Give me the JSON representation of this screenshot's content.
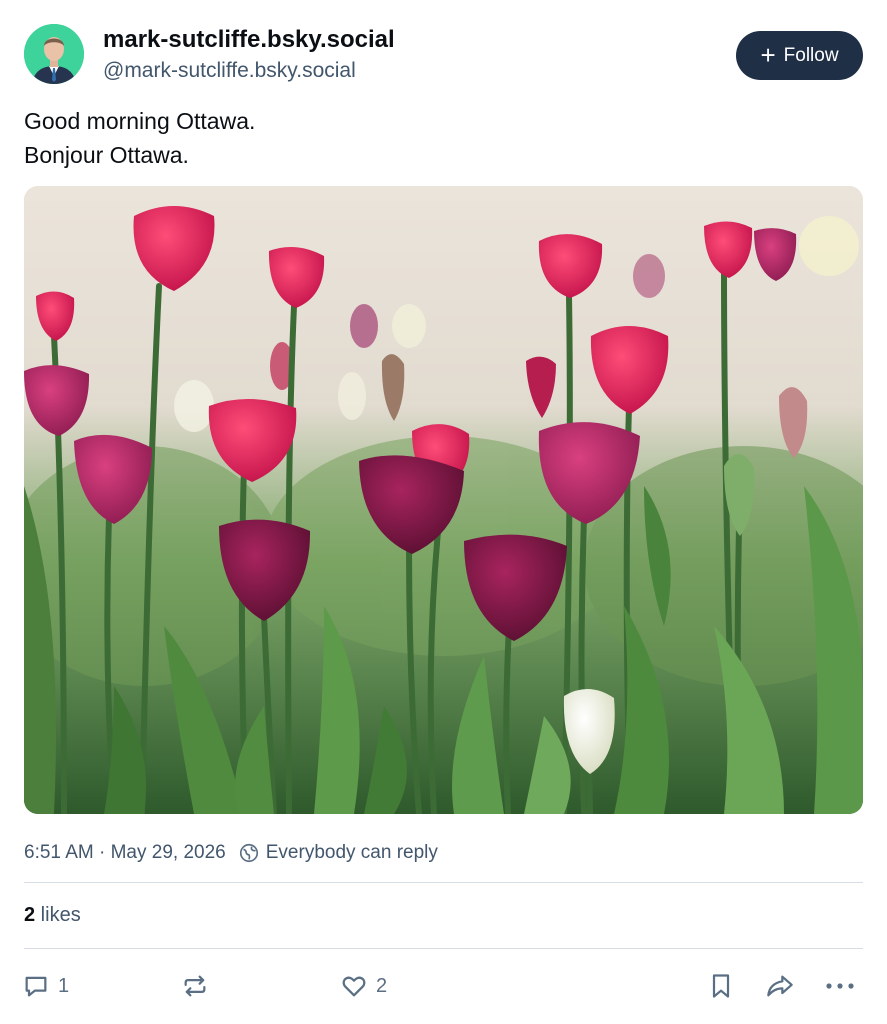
{
  "post": {
    "author": {
      "display_name": "mark-sutcliffe.bsky.social",
      "handle": "@mark-sutcliffe.bsky.social"
    },
    "follow_button": {
      "label": "Follow",
      "icon": "plus-icon"
    },
    "text_lines": [
      "Good morning Ottawa.",
      "Bonjour Ottawa."
    ],
    "image": {
      "subject": "tulips"
    },
    "meta": {
      "time": "6:51 AM",
      "separator": " · ",
      "date": "May 29, 2026",
      "reply_setting": "Everybody can reply",
      "reply_icon": "globe-icon"
    },
    "likes": {
      "count": "2",
      "label": " likes"
    },
    "actions": {
      "reply": {
        "icon": "comment-icon",
        "count": "1"
      },
      "repost": {
        "icon": "repost-icon",
        "count": ""
      },
      "like": {
        "icon": "heart-icon",
        "count": "2"
      },
      "bookmark": {
        "icon": "bookmark-icon"
      },
      "share": {
        "icon": "share-icon"
      },
      "more": {
        "icon": "more-icon"
      }
    }
  },
  "colors": {
    "text": "#0b0f14",
    "muted": "#42566c",
    "follow_bg": "#1f2f45",
    "divider": "#d6dde5",
    "avatar_bg": "#3ed39a"
  }
}
